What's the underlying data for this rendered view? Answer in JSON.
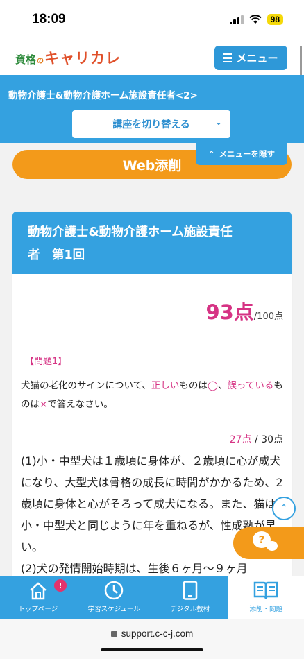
{
  "status": {
    "time": "18:09",
    "battery": "98"
  },
  "header": {
    "logo_small": "資格",
    "logo_no": "の",
    "logo_main": "キャリカレ",
    "menu_label": "メニュー"
  },
  "course": {
    "title": "動物介護士&動物介護ホーム施設責任者<2>",
    "switch_label": "講座を切り替える"
  },
  "web_button": "Web添削",
  "hide_menu": "メニューを隠す",
  "card": {
    "title_line1": "動物介護士&動物介護ホーム施設責任",
    "title_line2": "者　第1回",
    "score": "93点",
    "score_total": "/100点",
    "question_label": "【問題1】",
    "q_part1": "犬猫の老化のサインについて、",
    "q_correct": "正しい",
    "q_part2": "ものは",
    "q_circle": "◯",
    "q_part3": "、",
    "q_wrong": "誤っている",
    "q_part4": "ものは",
    "q_cross": "×",
    "q_part5": "で答えなさい。",
    "q_score": "27点",
    "q_score_total": " / 30点",
    "answer1": "(1)小・中型犬は１歳頃に身体が、２歳頃に心が成犬になり、大型犬は骨格の成長に時間がかかるため、2歳頃に身体と心がそろって成犬になる。また、猫は小・中型犬と同じように年を重ねるが、性成熟が早い。",
    "answer2": "(2)犬の発情開始時期は、生後６ヶ月～９ヶ月"
  },
  "tabs": [
    {
      "label": "トップページ",
      "icon": "home-icon",
      "badge": "!"
    },
    {
      "label": "学習スケジュール",
      "icon": "clock-icon"
    },
    {
      "label": "デジタル教材",
      "icon": "tablet-icon"
    },
    {
      "label": "添削・問題",
      "icon": "book-icon",
      "active": true
    }
  ],
  "url": "support.c-c-j.com",
  "colors": {
    "primary": "#34a1e0",
    "accent": "#f39a1a",
    "pink": "#d63384"
  }
}
